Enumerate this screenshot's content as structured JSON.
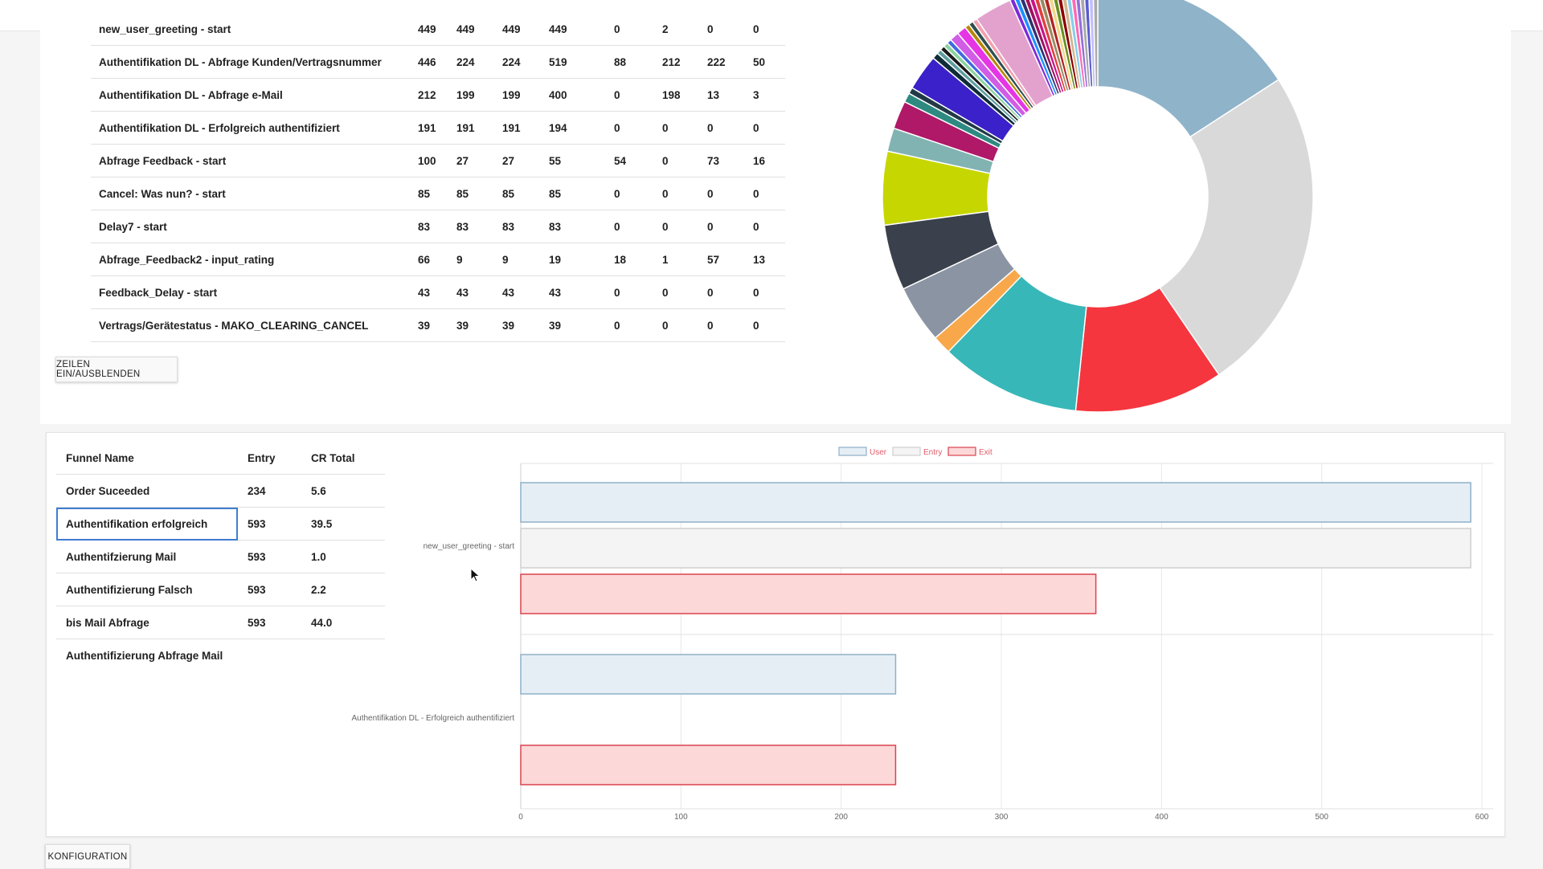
{
  "flow_table": {
    "rows": [
      {
        "name": "new_user_greeting - start",
        "vals": [
          "449",
          "449",
          "449",
          "449",
          "0",
          "2",
          "0",
          "0"
        ]
      },
      {
        "name": "Authentifikation DL - Abfrage Kunden/Vertragsnummer",
        "vals": [
          "446",
          "224",
          "224",
          "519",
          "88",
          "212",
          "222",
          "50"
        ]
      },
      {
        "name": "Authentifikation DL - Abfrage e-Mail",
        "vals": [
          "212",
          "199",
          "199",
          "400",
          "0",
          "198",
          "13",
          "3"
        ]
      },
      {
        "name": "Authentifikation DL - Erfolgreich authentifiziert",
        "vals": [
          "191",
          "191",
          "191",
          "194",
          "0",
          "0",
          "0",
          "0"
        ]
      },
      {
        "name": "Abfrage Feedback - start",
        "vals": [
          "100",
          "27",
          "27",
          "55",
          "54",
          "0",
          "73",
          "16"
        ]
      },
      {
        "name": "Cancel: Was nun? - start",
        "vals": [
          "85",
          "85",
          "85",
          "85",
          "0",
          "0",
          "0",
          "0"
        ]
      },
      {
        "name": "Delay7 - start",
        "vals": [
          "83",
          "83",
          "83",
          "83",
          "0",
          "0",
          "0",
          "0"
        ]
      },
      {
        "name": "Abfrage_Feedback2 - input_rating",
        "vals": [
          "66",
          "9",
          "9",
          "19",
          "18",
          "1",
          "57",
          "13"
        ]
      },
      {
        "name": "Feedback_Delay - start",
        "vals": [
          "43",
          "43",
          "43",
          "43",
          "0",
          "0",
          "0",
          "0"
        ]
      },
      {
        "name": "Vertrags/Gerätestatus - MAKO_CLEARING_CANCEL",
        "vals": [
          "39",
          "39",
          "39",
          "39",
          "0",
          "0",
          "0",
          "0"
        ]
      }
    ]
  },
  "toggle_rows_label": "ZEILEN EIN/AUSBLENDEN",
  "config_label": "KONFIGURATION",
  "funnel_table": {
    "headers": [
      "Funnel Name",
      "Entry",
      "CR Total"
    ],
    "rows": [
      {
        "name": "Order Suceeded",
        "entry": "234",
        "cr": "5.6"
      },
      {
        "name": "Authentifikation erfolgreich",
        "entry": "593",
        "cr": "39.5"
      },
      {
        "name": "Authentifzierung Mail",
        "entry": "593",
        "cr": "1.0"
      },
      {
        "name": "Authentifizierung Falsch",
        "entry": "593",
        "cr": "2.2"
      },
      {
        "name": "bis Mail Abfrage",
        "entry": "593",
        "cr": "44.0"
      },
      {
        "name": "Authentifizierung Abfrage Mail",
        "entry": "",
        "cr": ""
      }
    ]
  },
  "colors": {
    "user_fill": "#e6eef5",
    "user_stroke": "#8fb0c8",
    "entry_fill": "#f4f4f4",
    "entry_stroke": "#cfcfcf",
    "exit_fill": "#fdd8d8",
    "exit_stroke": "#d9444f",
    "legend_text": "#e05c6a"
  },
  "chart_data": [
    {
      "type": "pie",
      "variant": "donut",
      "slices": [
        {
          "value": 13.5,
          "color": "#8fb3c9"
        },
        {
          "value": 21.0,
          "color": "#d9d9d9"
        },
        {
          "value": 9.5,
          "color": "#f5363f"
        },
        {
          "value": 9.0,
          "color": "#38b7b8"
        },
        {
          "value": 1.2,
          "color": "#f8a84a"
        },
        {
          "value": 3.7,
          "color": "#8b94a3"
        },
        {
          "value": 4.2,
          "color": "#3b414c"
        },
        {
          "value": 4.7,
          "color": "#c6d600"
        },
        {
          "value": 1.5,
          "color": "#82b3b3"
        },
        {
          "value": 1.8,
          "color": "#b01868"
        },
        {
          "value": 0.6,
          "color": "#2e8a80"
        },
        {
          "value": 0.4,
          "color": "#213a46"
        },
        {
          "value": 2.3,
          "color": "#3a21c9"
        },
        {
          "value": 0.4,
          "color": "#0f2c38"
        },
        {
          "value": 0.3,
          "color": "#5f9ea0"
        },
        {
          "value": 0.3,
          "color": "#1a1a1a"
        },
        {
          "value": 0.3,
          "color": "#8cd3a0"
        },
        {
          "value": 0.3,
          "color": "#4169e1"
        },
        {
          "value": 0.6,
          "color": "#d15ce5"
        },
        {
          "value": 0.6,
          "color": "#e535e5"
        },
        {
          "value": 0.3,
          "color": "#b8860b"
        },
        {
          "value": 0.3,
          "color": "#2f4f4f"
        },
        {
          "value": 0.3,
          "color": "#f4a0b0"
        },
        {
          "value": 2.4,
          "color": "#e3a2cd"
        },
        {
          "value": 0.3,
          "color": "#7c2bd6"
        },
        {
          "value": 0.3,
          "color": "#1e90ff"
        },
        {
          "value": 0.3,
          "color": "#303070"
        },
        {
          "value": 0.3,
          "color": "#a01060"
        },
        {
          "value": 0.3,
          "color": "#c71585"
        },
        {
          "value": 0.3,
          "color": "#e04040"
        },
        {
          "value": 0.3,
          "color": "#9a8a60"
        },
        {
          "value": 0.3,
          "color": "#b22222"
        },
        {
          "value": 0.3,
          "color": "#f0d88a"
        },
        {
          "value": 0.3,
          "color": "#6b8e23"
        },
        {
          "value": 0.3,
          "color": "#8b0000"
        },
        {
          "value": 0.3,
          "color": "#d2b48c"
        },
        {
          "value": 0.3,
          "color": "#87ceeb"
        },
        {
          "value": 0.3,
          "color": "#ff69b4"
        },
        {
          "value": 0.3,
          "color": "#9370db"
        },
        {
          "value": 0.3,
          "color": "#a9a9a9"
        },
        {
          "value": 0.3,
          "color": "#5a5ad0"
        },
        {
          "value": 0.3,
          "color": "#c0c0ff"
        },
        {
          "value": 0.3,
          "color": "#aaaaaa"
        }
      ]
    },
    {
      "type": "bar",
      "orientation": "horizontal",
      "categories": [
        "new_user_greeting - start",
        "Authentifikation DL - Erfolgreich authentifiziert"
      ],
      "series": [
        {
          "name": "User",
          "values": [
            593,
            234
          ]
        },
        {
          "name": "Entry",
          "values": [
            593,
            0
          ]
        },
        {
          "name": "Exit",
          "values": [
            359,
            234
          ]
        }
      ],
      "xlim": [
        0,
        600
      ],
      "xticks": [
        "0",
        "100",
        "200",
        "300",
        "400",
        "500",
        "600"
      ],
      "legend": "top",
      "grid": true
    }
  ]
}
